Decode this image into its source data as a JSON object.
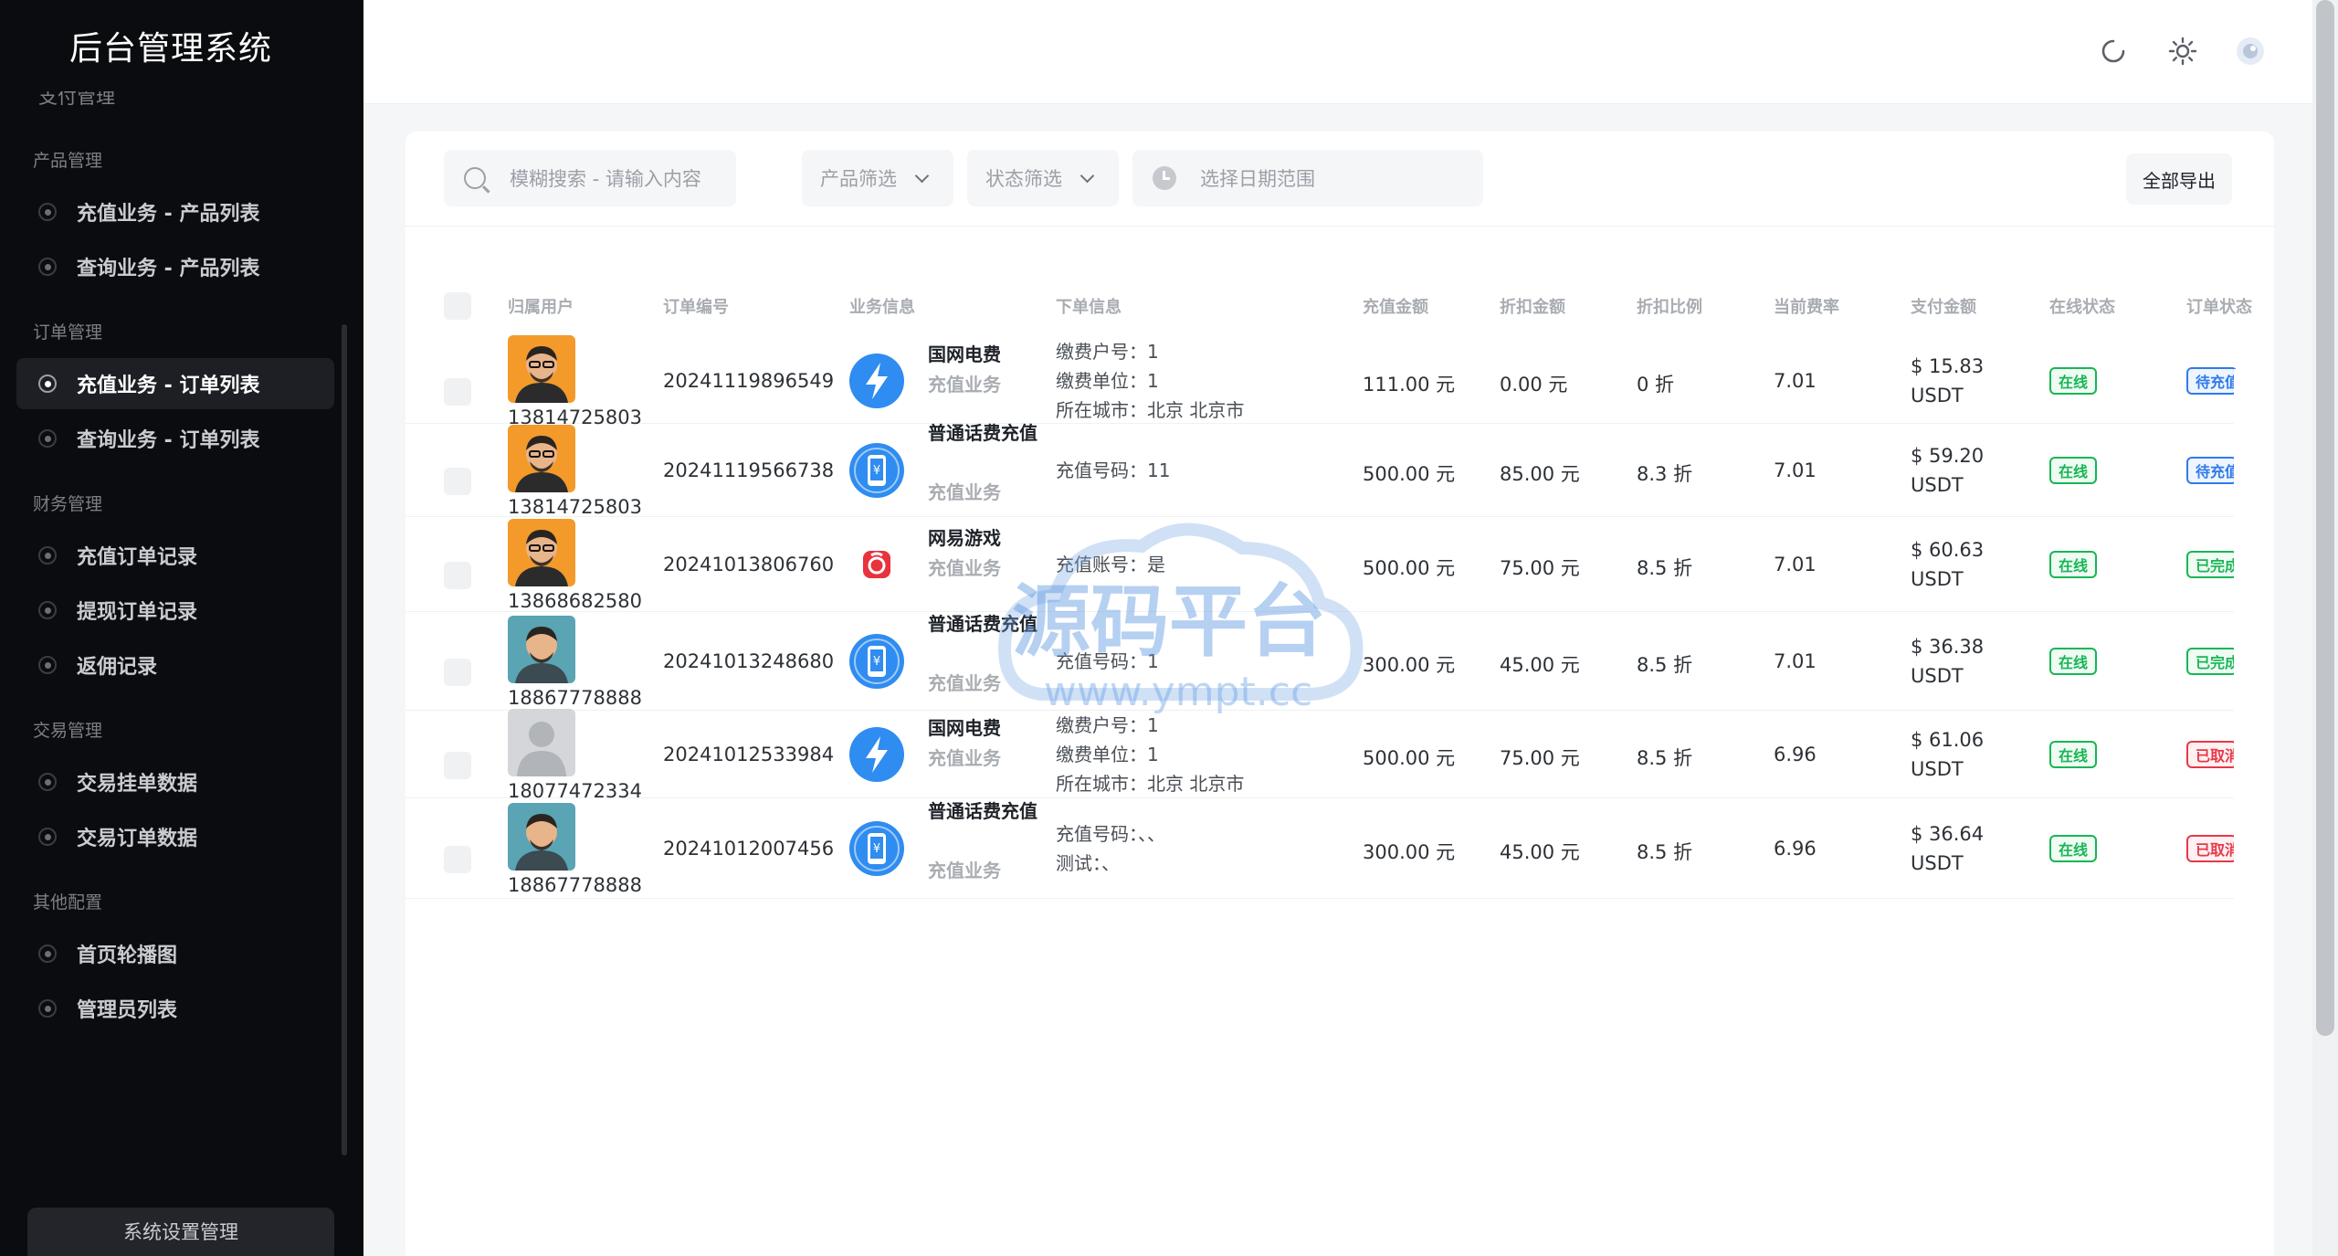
{
  "app": {
    "title": "后台管理系统"
  },
  "sidebar": {
    "cut_item": "支付管理",
    "groups": [
      {
        "title": "产品管理",
        "items": [
          "充值业务 - 产品列表",
          "查询业务 - 产品列表"
        ]
      },
      {
        "title": "订单管理",
        "items": [
          "充值业务 - 订单列表",
          "查询业务 - 订单列表"
        ]
      },
      {
        "title": "财务管理",
        "items": [
          "充值订单记录",
          "提现订单记录",
          "返佣记录"
        ]
      },
      {
        "title": "交易管理",
        "items": [
          "交易挂单数据",
          "交易订单数据"
        ]
      },
      {
        "title": "其他配置",
        "items": [
          "首页轮播图",
          "管理员列表"
        ]
      }
    ],
    "active_item": "充值业务 - 订单列表",
    "settings_label": "系统设置管理"
  },
  "header": {
    "icons": [
      "refresh-icon",
      "sun-icon",
      "admin-avatar"
    ]
  },
  "toolbar": {
    "search_placeholder": "模糊搜索 - 请输入内容",
    "product_filter": "产品筛选",
    "status_filter": "状态筛选",
    "date_placeholder": "选择日期范围",
    "export_label": "全部导出"
  },
  "table": {
    "headers": [
      "归属用户",
      "订单编号",
      "业务信息",
      "下单信息",
      "充值金额",
      "折扣金额",
      "折扣比例",
      "当前费率",
      "支付金额",
      "在线状态",
      "订单状态"
    ],
    "rows": [
      {
        "user": "13814725803",
        "avatar": "orange",
        "order_no": "20241119896549",
        "biz_name": "国网电费",
        "biz_type": "充值业务",
        "biz_icon": "bolt",
        "info": [
          "缴费户号：1",
          "缴费单位：1",
          "所在城市：北京 北京市"
        ],
        "amount": "111.00 元",
        "discount": "0.00 元",
        "ratio": "0 折",
        "rate": "7.01",
        "pay": "$ 15.83",
        "currency": "USDT",
        "online": "在线",
        "status": "待充值",
        "status_type": "pending"
      },
      {
        "user": "13814725803",
        "avatar": "orange",
        "order_no": "20241119566738",
        "biz_name": "普通话费充值",
        "biz_type": "充值业务",
        "biz_icon": "phone",
        "info": [
          "充值号码：11"
        ],
        "amount": "500.00 元",
        "discount": "85.00 元",
        "ratio": "8.3 折",
        "rate": "7.01",
        "pay": "$ 59.20",
        "currency": "USDT",
        "online": "在线",
        "status": "待充值",
        "status_type": "pending"
      },
      {
        "user": "13868682580",
        "avatar": "orange",
        "order_no": "20241013806760",
        "biz_name": "网易游戏",
        "biz_type": "充值业务",
        "biz_icon": "netease",
        "info": [
          "充值账号：是"
        ],
        "amount": "500.00 元",
        "discount": "75.00 元",
        "ratio": "8.5 折",
        "rate": "7.01",
        "pay": "$ 60.63",
        "currency": "USDT",
        "online": "在线",
        "status": "已完成",
        "status_type": "done"
      },
      {
        "user": "18867778888",
        "avatar": "teal",
        "order_no": "20241013248680",
        "biz_name": "普通话费充值",
        "biz_type": "充值业务",
        "biz_icon": "phone",
        "info": [
          "充值号码：1"
        ],
        "amount": "300.00 元",
        "discount": "45.00 元",
        "ratio": "8.5 折",
        "rate": "7.01",
        "pay": "$ 36.38",
        "currency": "USDT",
        "online": "在线",
        "status": "已完成",
        "status_type": "done"
      },
      {
        "user": "18077472334",
        "avatar": "gray",
        "order_no": "20241012533984",
        "biz_name": "国网电费",
        "biz_type": "充值业务",
        "biz_icon": "bolt",
        "info": [
          "缴费户号：1",
          "缴费单位：1",
          "所在城市：北京 北京市"
        ],
        "amount": "500.00 元",
        "discount": "75.00 元",
        "ratio": "8.5 折",
        "rate": "6.96",
        "pay": "$ 61.06",
        "currency": "USDT",
        "online": "在线",
        "status": "已取消",
        "status_type": "cancel"
      },
      {
        "user": "18867778888",
        "avatar": "teal",
        "order_no": "20241012007456",
        "biz_name": "普通话费充值",
        "biz_type": "充值业务",
        "biz_icon": "phone",
        "info": [
          "充值号码：、、",
          "测试：、"
        ],
        "amount": "300.00 元",
        "discount": "45.00 元",
        "ratio": "8.5 折",
        "rate": "6.96",
        "pay": "$ 36.64",
        "currency": "USDT",
        "online": "在线",
        "status": "已取消",
        "status_type": "cancel"
      }
    ]
  },
  "watermark": {
    "title": "源码平台",
    "url": "www.ympt.cc"
  },
  "colors": {
    "sidebar_bg": "#0b0c0f",
    "accent_blue": "#2f7bea",
    "online_green": "#18b655",
    "cancel_red": "#e5394a"
  }
}
